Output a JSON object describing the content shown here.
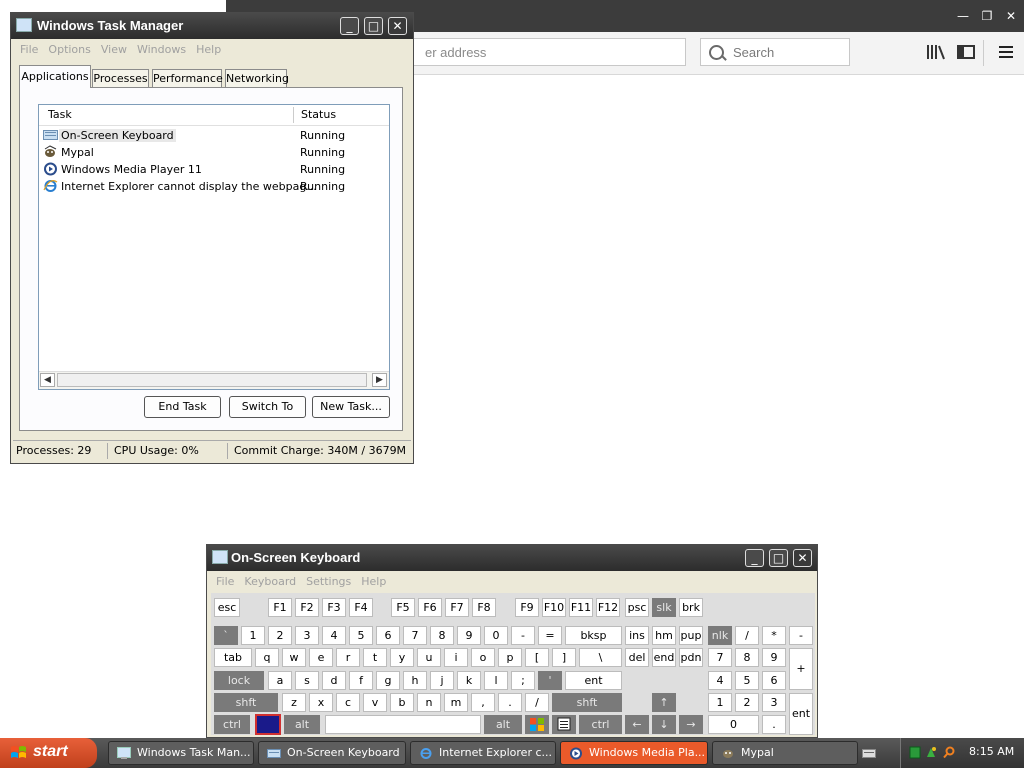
{
  "browser": {
    "url_placeholder": "er address",
    "search_placeholder": "Search"
  },
  "task_manager": {
    "title": "Windows Task Manager",
    "menu": [
      "File",
      "Options",
      "View",
      "Windows",
      "Help"
    ],
    "tabs": [
      "Applications",
      "Processes",
      "Performance",
      "Networking"
    ],
    "active_tab": "Applications",
    "columns": {
      "task": "Task",
      "status": "Status"
    },
    "rows": [
      {
        "name": "On-Screen Keyboard",
        "status": "Running",
        "icon": "keyboard-icon"
      },
      {
        "name": "Mypal",
        "status": "Running",
        "icon": "mypal-icon"
      },
      {
        "name": "Windows Media Player 11",
        "status": "Running",
        "icon": "media-player-icon"
      },
      {
        "name": "Internet Explorer cannot display the webpag...",
        "status": "Running",
        "icon": "ie-icon"
      }
    ],
    "buttons": {
      "end_task": "End Task",
      "switch_to": "Switch To",
      "new_task": "New Task..."
    },
    "status": {
      "processes": "Processes: 29",
      "cpu": "CPU Usage: 0%",
      "commit": "Commit Charge: 340M / 3679M"
    }
  },
  "osk": {
    "title": "On-Screen Keyboard",
    "menu": [
      "File",
      "Keyboard",
      "Settings",
      "Help"
    ],
    "row_fn": [
      "esc",
      "F1",
      "F2",
      "F3",
      "F4",
      "F5",
      "F6",
      "F7",
      "F8",
      "F9",
      "F10",
      "F11",
      "F12",
      "psc",
      "slk",
      "brk"
    ],
    "row_num": [
      "`",
      "1",
      "2",
      "3",
      "4",
      "5",
      "6",
      "7",
      "8",
      "9",
      "0",
      "-",
      "=",
      "bksp",
      "ins",
      "hm",
      "pup",
      "nlk",
      "/",
      "*",
      "-"
    ],
    "row_q": [
      "tab",
      "q",
      "w",
      "e",
      "r",
      "t",
      "y",
      "u",
      "i",
      "o",
      "p",
      "[",
      "]",
      "\\",
      "del",
      "end",
      "pdn",
      "7",
      "8",
      "9",
      "+"
    ],
    "row_a": [
      "lock",
      "a",
      "s",
      "d",
      "f",
      "g",
      "h",
      "j",
      "k",
      "l",
      ";",
      "'",
      "ent",
      "4",
      "5",
      "6"
    ],
    "row_z": [
      "shft",
      "z",
      "x",
      "c",
      "v",
      "b",
      "n",
      "m",
      ",",
      ".",
      "/",
      "shft",
      "↑",
      "1",
      "2",
      "3",
      "ent"
    ],
    "row_ctrl": [
      "ctrl",
      "",
      "alt",
      "",
      "alt",
      "",
      "",
      "ctrl",
      "←",
      "↓",
      "→",
      "0",
      "."
    ]
  },
  "taskbar": {
    "start": "start",
    "items": [
      {
        "label": "Windows Task Man...",
        "icon": "task-manager-icon",
        "active": false
      },
      {
        "label": "On-Screen Keyboard",
        "icon": "keyboard-icon",
        "active": false
      },
      {
        "label": "Internet Explorer c...",
        "icon": "ie-icon",
        "active": false
      },
      {
        "label": "Windows Media Pla...",
        "icon": "media-player-icon",
        "active": true
      },
      {
        "label": "Mypal",
        "icon": "mypal-icon",
        "active": false
      }
    ],
    "clock": "8:15 AM"
  },
  "colors": {
    "accent": "#ea5a2a",
    "titlebar": "#3c3c3c",
    "window_bg": "#ece9d8"
  }
}
